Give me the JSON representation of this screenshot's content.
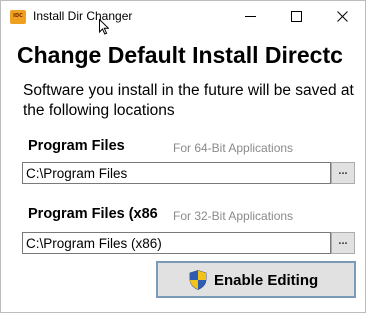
{
  "window": {
    "title": "Install Dir Changer",
    "icon_text": "IDC",
    "controls": [
      "minimize",
      "maximize",
      "close"
    ]
  },
  "heading": "Change Default Install Directc",
  "description": "Software you install in the future will be saved at the following locations",
  "program_files": {
    "label": "Program Files",
    "hint": "For 64-Bit Applications",
    "value": "C:\\Program Files",
    "browse_label": "..."
  },
  "program_files_x86": {
    "label": "Program Files (x86",
    "hint": "For 32-Bit Applications",
    "value": "C:\\Program Files (x86)",
    "browse_label": "..."
  },
  "enable_button": {
    "label": "Enable Editing",
    "icon": "uac-shield-icon"
  },
  "colors": {
    "icon_orange": "#f0a020",
    "button_border": "#7a9ab5",
    "button_face": "#e1e1e1",
    "hint_gray": "#8a8a8a"
  }
}
